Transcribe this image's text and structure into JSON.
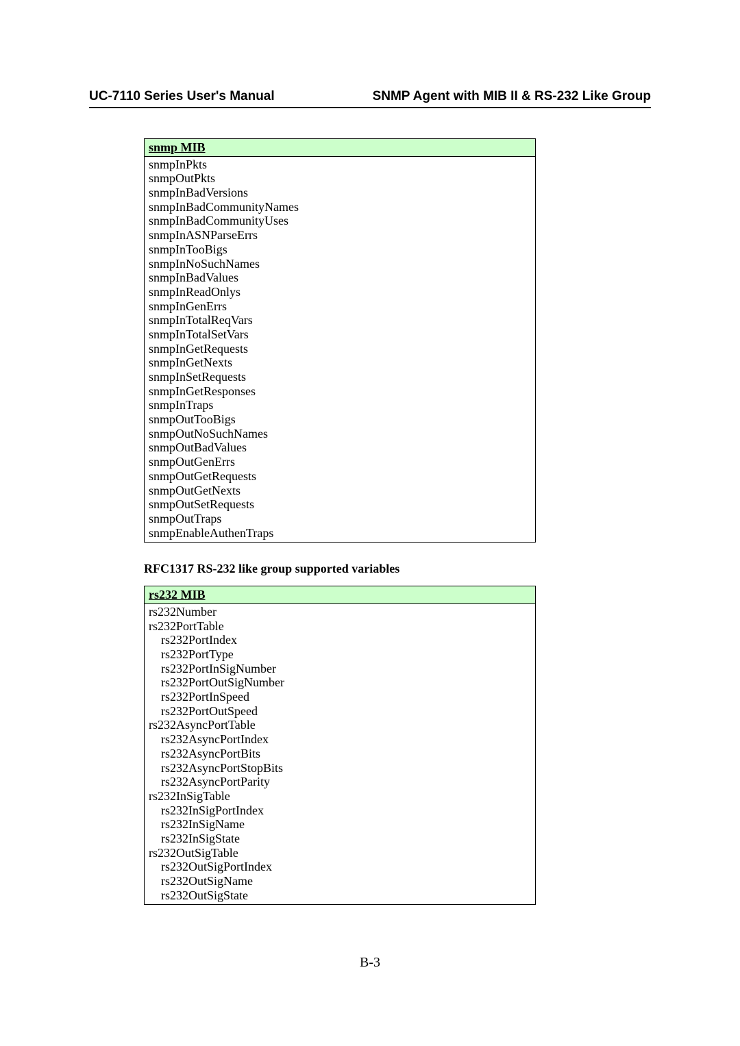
{
  "header": {
    "left": "UC-7110 Series User's Manual",
    "right": "SNMP Agent with MIB II & RS-232 Like Group"
  },
  "snmp_mib": {
    "title": "snmp MIB",
    "rows": [
      {
        "t": "snmpInPkts",
        "i": 0
      },
      {
        "t": "snmpOutPkts",
        "i": 0
      },
      {
        "t": "snmpInBadVersions",
        "i": 0
      },
      {
        "t": "snmpInBadCommunityNames",
        "i": 0
      },
      {
        "t": "snmpInBadCommunityUses",
        "i": 0
      },
      {
        "t": "snmpInASNParseErrs",
        "i": 0
      },
      {
        "t": "snmpInTooBigs",
        "i": 0
      },
      {
        "t": "snmpInNoSuchNames",
        "i": 0
      },
      {
        "t": "snmpInBadValues",
        "i": 0
      },
      {
        "t": "snmpInReadOnlys",
        "i": 0
      },
      {
        "t": "snmpInGenErrs",
        "i": 0
      },
      {
        "t": "snmpInTotalReqVars",
        "i": 0
      },
      {
        "t": "snmpInTotalSetVars",
        "i": 0
      },
      {
        "t": "snmpInGetRequests",
        "i": 0
      },
      {
        "t": "snmpInGetNexts",
        "i": 0
      },
      {
        "t": "snmpInSetRequests",
        "i": 0
      },
      {
        "t": "snmpInGetResponses",
        "i": 0
      },
      {
        "t": "snmpInTraps",
        "i": 0
      },
      {
        "t": "snmpOutTooBigs",
        "i": 0
      },
      {
        "t": "snmpOutNoSuchNames",
        "i": 0
      },
      {
        "t": "snmpOutBadValues",
        "i": 0
      },
      {
        "t": "snmpOutGenErrs",
        "i": 0
      },
      {
        "t": "snmpOutGetRequests",
        "i": 0
      },
      {
        "t": "snmpOutGetNexts",
        "i": 0
      },
      {
        "t": "snmpOutSetRequests",
        "i": 0
      },
      {
        "t": "snmpOutTraps",
        "i": 0
      },
      {
        "t": "snmpEnableAuthenTraps",
        "i": 0
      }
    ]
  },
  "rs232_section_title": "RFC1317 RS-232 like group supported variables",
  "rs232_mib": {
    "title": "rs232 MIB",
    "rows": [
      {
        "t": "rs232Number",
        "i": 0
      },
      {
        "t": "rs232PortTable",
        "i": 0
      },
      {
        "t": "rs232PortIndex",
        "i": 1
      },
      {
        "t": "rs232PortType",
        "i": 1
      },
      {
        "t": "rs232PortInSigNumber",
        "i": 1
      },
      {
        "t": "rs232PortOutSigNumber",
        "i": 1
      },
      {
        "t": "rs232PortInSpeed",
        "i": 1
      },
      {
        "t": "rs232PortOutSpeed",
        "i": 1
      },
      {
        "t": "rs232AsyncPortTable",
        "i": 0
      },
      {
        "t": "rs232AsyncPortIndex",
        "i": 1
      },
      {
        "t": "rs232AsyncPortBits",
        "i": 1
      },
      {
        "t": "rs232AsyncPortStopBits",
        "i": 1
      },
      {
        "t": "rs232AsyncPortParity",
        "i": 1
      },
      {
        "t": "rs232InSigTable",
        "i": 0
      },
      {
        "t": "rs232InSigPortIndex",
        "i": 1
      },
      {
        "t": "rs232InSigName",
        "i": 1
      },
      {
        "t": "rs232InSigState",
        "i": 1
      },
      {
        "t": "rs232OutSigTable",
        "i": 0
      },
      {
        "t": "rs232OutSigPortIndex",
        "i": 1
      },
      {
        "t": "rs232OutSigName",
        "i": 1
      },
      {
        "t": "rs232OutSigState",
        "i": 1
      }
    ]
  },
  "page_number": "B-3"
}
